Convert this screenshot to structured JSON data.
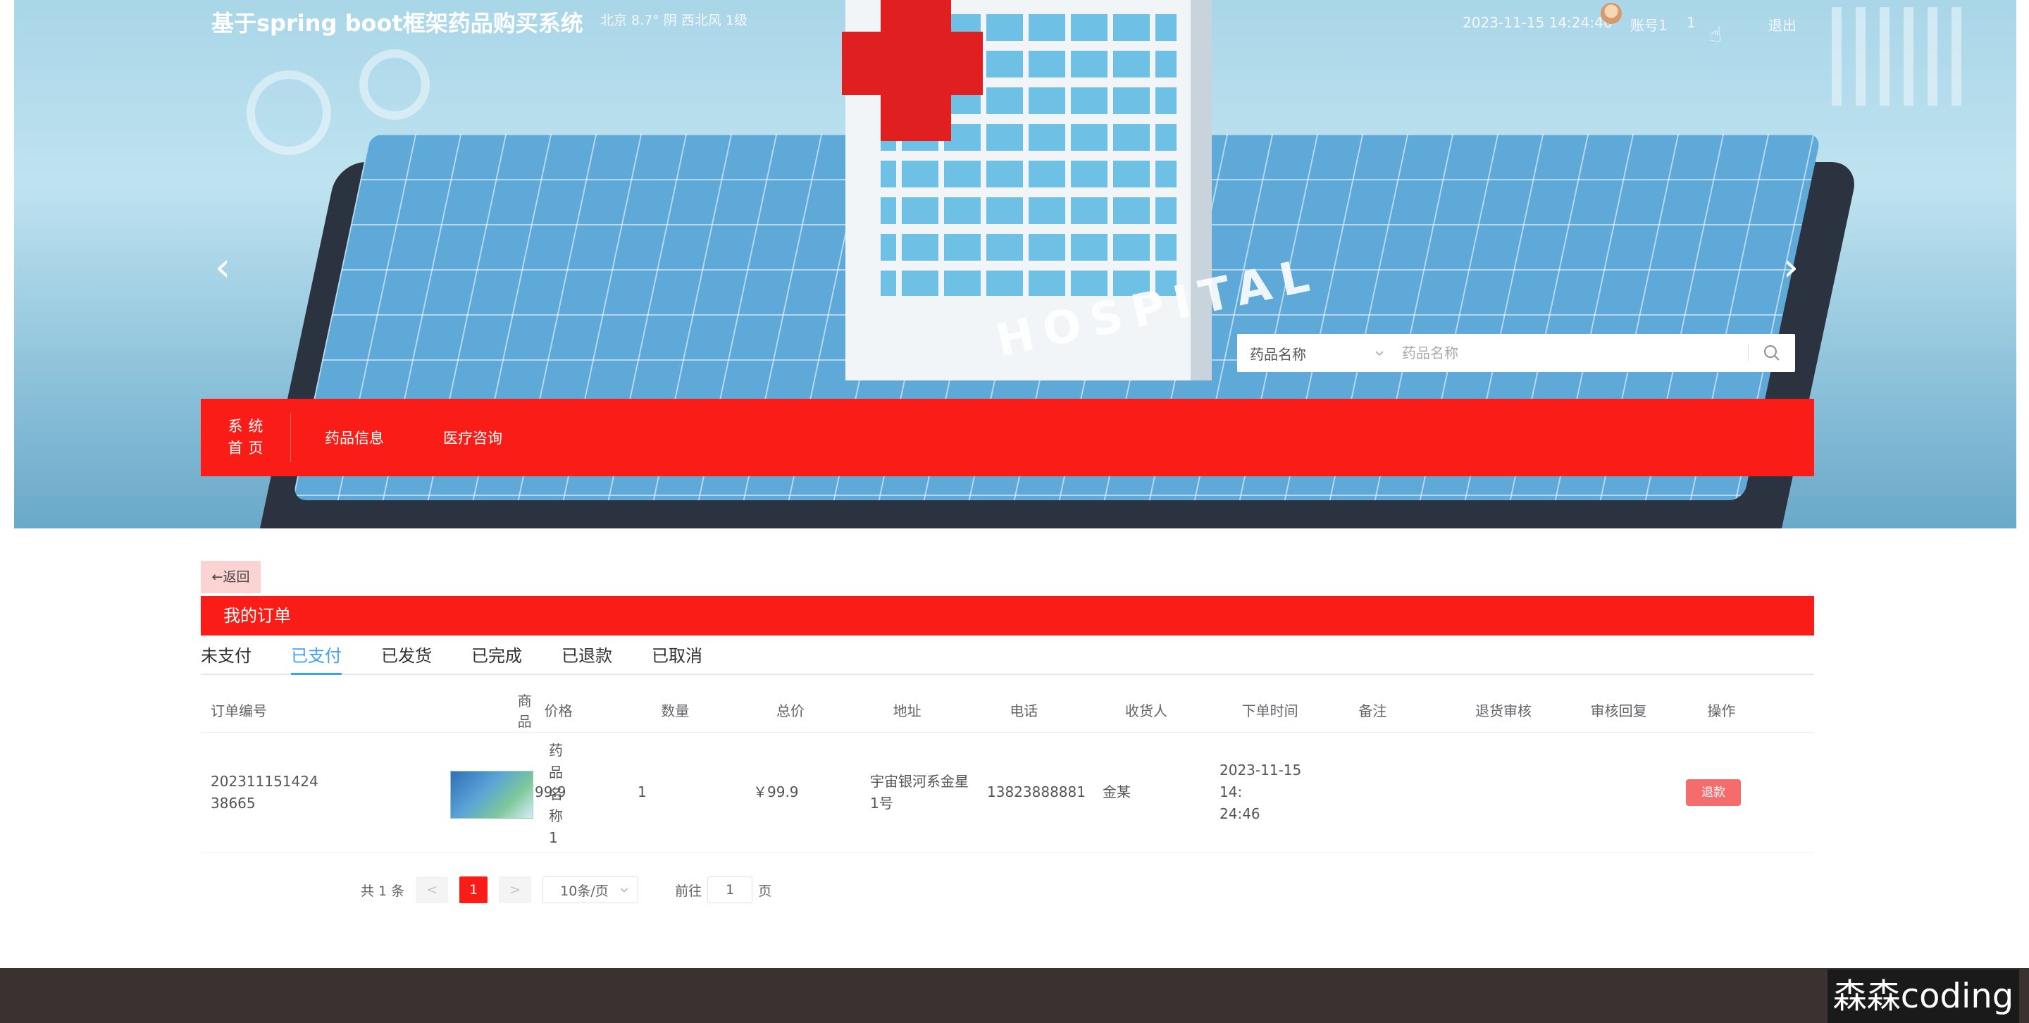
{
  "header": {
    "site_title": "基于spring boot框架药品购买系统",
    "weather": "北京  8.7°  阴  西北风  1级",
    "datetime": "2023-11-15 14:24:46",
    "account_label": "账号1",
    "account_number": "1",
    "logout_label": "退出"
  },
  "hero": {
    "building_text": "HOSPITAL",
    "prev_arrow": "‹",
    "next_arrow": "›"
  },
  "search": {
    "select_value": "药品名称",
    "input_placeholder": "药品名称"
  },
  "nav": {
    "home_line1": "系统",
    "home_line2": "首页",
    "items": [
      {
        "label": "药品信息"
      },
      {
        "label": "医疗咨询"
      }
    ]
  },
  "content": {
    "back_label": "←返回",
    "section_title": "我的订单",
    "tabs": [
      {
        "label": "未支付",
        "active": false
      },
      {
        "label": "已支付",
        "active": true
      },
      {
        "label": "已发货",
        "active": false
      },
      {
        "label": "已完成",
        "active": false
      },
      {
        "label": "已退款",
        "active": false
      },
      {
        "label": "已取消",
        "active": false
      }
    ],
    "table": {
      "columns": [
        "订单编号",
        "商品",
        "价格",
        "数量",
        "总价",
        "地址",
        "电话",
        "收货人",
        "下单时间",
        "备注",
        "退货审核",
        "审核回复",
        "操作"
      ],
      "rows": [
        {
          "order_no_1": "202311151424",
          "order_no_2": "38665",
          "goods_name": "药品名称1",
          "price": "￥99.9",
          "quantity": "1",
          "total": "￥99.9",
          "address_1": "宇宙银河系金星",
          "address_2": "1号",
          "phone": "13823888881",
          "receiver": "金某",
          "time_1": "2023-11-15 14:",
          "time_2": "24:46",
          "remark": "",
          "refund_review": "",
          "review_reply": "",
          "action_label": "退款"
        }
      ]
    },
    "pagination": {
      "total_text": "共 1 条",
      "prev": "<",
      "current_page": "1",
      "next": ">",
      "page_size": "10条/页",
      "goto_prefix": "前往",
      "goto_value": "1",
      "goto_suffix": "页"
    }
  },
  "watermark": "森森coding",
  "colors": {
    "primary_red": "#fa1c16",
    "tab_active": "#409eff",
    "refund_button": "#f56c6c",
    "footer": "#3a3131"
  },
  "icons": {
    "search": "search-icon",
    "chevron": "chevron-down-icon",
    "prev": "chevron-left-icon",
    "next": "chevron-right-icon"
  }
}
